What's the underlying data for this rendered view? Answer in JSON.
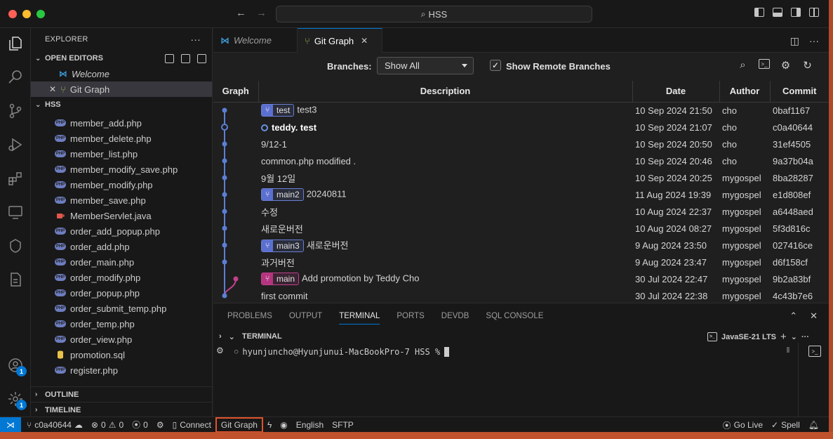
{
  "titlebar": {
    "search_text": "HSS"
  },
  "explorer": {
    "title": "EXPLORER",
    "more": "···",
    "open_editors_label": "OPEN EDITORS",
    "open_editors": [
      {
        "label": "Welcome",
        "italic": true
      },
      {
        "label": "Git Graph",
        "active": true
      }
    ],
    "folder_label": "HSS",
    "files": [
      {
        "name": "member_add.php",
        "type": "php"
      },
      {
        "name": "member_delete.php",
        "type": "php"
      },
      {
        "name": "member_list.php",
        "type": "php"
      },
      {
        "name": "member_modify_save.php",
        "type": "php"
      },
      {
        "name": "member_modify.php",
        "type": "php"
      },
      {
        "name": "member_save.php",
        "type": "php"
      },
      {
        "name": "MemberServlet.java",
        "type": "java"
      },
      {
        "name": "order_add_popup.php",
        "type": "php"
      },
      {
        "name": "order_add.php",
        "type": "php"
      },
      {
        "name": "order_main.php",
        "type": "php"
      },
      {
        "name": "order_modify.php",
        "type": "php"
      },
      {
        "name": "order_popup.php",
        "type": "php"
      },
      {
        "name": "order_submit_temp.php",
        "type": "php"
      },
      {
        "name": "order_temp.php",
        "type": "php"
      },
      {
        "name": "order_view.php",
        "type": "php"
      },
      {
        "name": "promotion.sql",
        "type": "sql"
      },
      {
        "name": "register.php",
        "type": "php"
      }
    ],
    "outline_label": "OUTLINE",
    "timeline_label": "TIMELINE",
    "php_icon_text": "PHP"
  },
  "activity": {
    "accounts_badge": "1",
    "settings_badge": "1"
  },
  "tabs": [
    {
      "label": "Welcome",
      "active": false
    },
    {
      "label": "Git Graph",
      "active": true
    }
  ],
  "gitgraph": {
    "branches_label": "Branches:",
    "branches_value": "Show All",
    "remote_label": "Show Remote Branches",
    "remote_checked": "✓",
    "columns": [
      "Graph",
      "Description",
      "Date",
      "Author",
      "Commit"
    ],
    "commits": [
      {
        "ref": "test",
        "ref_color": "blue",
        "desc": "test3",
        "date": "10 Sep 2024 21:50",
        "author": "cho",
        "hash": "0baf1167"
      },
      {
        "head": true,
        "desc": "teddy. test",
        "date": "10 Sep 2024 21:07",
        "author": "cho",
        "hash": "c0a40644"
      },
      {
        "desc": "9/12-1",
        "date": "10 Sep 2024 20:50",
        "author": "cho",
        "hash": "31ef4505"
      },
      {
        "desc": "common.php modified .",
        "date": "10 Sep 2024 20:46",
        "author": "cho",
        "hash": "9a37b04a"
      },
      {
        "desc": "9월 12일",
        "date": "10 Sep 2024 20:25",
        "author": "mygospel",
        "hash": "8ba28287"
      },
      {
        "ref": "main2",
        "ref_color": "blue",
        "desc": "20240811",
        "date": "11 Aug 2024 19:39",
        "author": "mygospel",
        "hash": "e1d808ef"
      },
      {
        "desc": "수정",
        "date": "10 Aug 2024 22:37",
        "author": "mygospel",
        "hash": "a6448aed"
      },
      {
        "desc": "새로운버전",
        "date": "10 Aug 2024 08:27",
        "author": "mygospel",
        "hash": "5f3d816c"
      },
      {
        "ref": "main3",
        "ref_color": "blue",
        "desc": "새로운버전",
        "date": "9 Aug 2024 23:50",
        "author": "mygospel",
        "hash": "027416ce"
      },
      {
        "desc": "과거버전",
        "date": "9 Aug 2024 23:47",
        "author": "mygospel",
        "hash": "d6f158cf"
      },
      {
        "ref": "main",
        "ref_color": "pink",
        "desc": "Add promotion by Teddy Cho",
        "date": "30 Jul 2024 22:47",
        "author": "mygospel",
        "hash": "9b2a83bf"
      },
      {
        "desc": "first commit",
        "date": "30 Jul 2024 22:38",
        "author": "mygospel",
        "hash": "4c43b7e6"
      }
    ]
  },
  "panel": {
    "tabs": [
      "PROBLEMS",
      "OUTPUT",
      "TERMINAL",
      "PORTS",
      "DEVDB",
      "SQL CONSOLE"
    ],
    "active_tab": "TERMINAL",
    "terminal_label": "TERMINAL",
    "profile": "JavaSE-21 LTS",
    "prompt": "hyunjuncho@Hyunjunui-MacBookPro-7 HSS %"
  },
  "statusbar": {
    "branch": "c0a40644",
    "errors": "0",
    "warnings": "0",
    "ports": "0",
    "connect": "Connect",
    "gitgraph": "Git Graph",
    "language": "English",
    "sftp": "SFTP",
    "golive": "Go Live",
    "spell": "Spell"
  },
  "colors": {
    "accent": "#0078d4",
    "graph_blue": "#5b7fd6",
    "graph_pink": "#c2418c",
    "highlight": "#e0522a"
  }
}
